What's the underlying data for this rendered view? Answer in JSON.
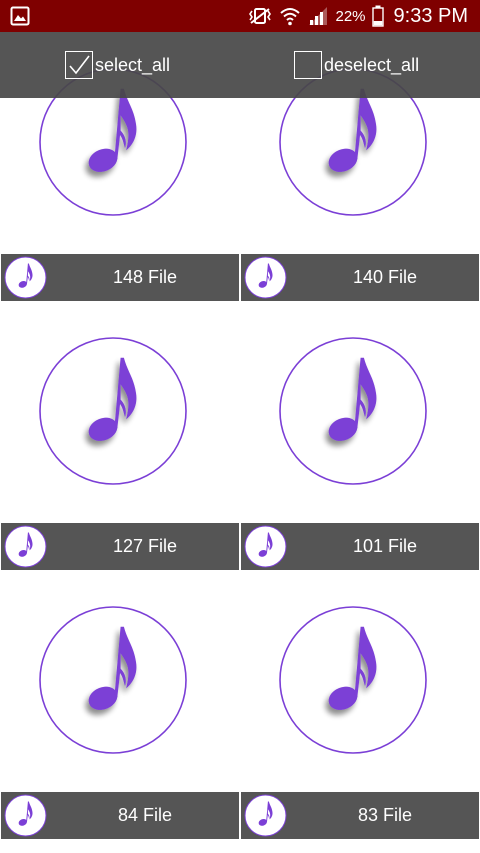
{
  "status_bar": {
    "battery_percent": "22%",
    "time": "9:33 PM",
    "bg_color": "#7f0000"
  },
  "toolbar": {
    "select_all_label": "select_all",
    "select_all_checked": true,
    "deselect_all_label": "deselect_all",
    "deselect_all_checked": false
  },
  "tiles": [
    {
      "count_label": "148 File"
    },
    {
      "count_label": "140 File"
    },
    {
      "count_label": "127 File"
    },
    {
      "count_label": "101 File"
    },
    {
      "count_label": "84 File"
    },
    {
      "count_label": "83 File"
    }
  ],
  "colors": {
    "accent": "#7b3fd6",
    "tile_bar": "#555555",
    "toolbar": "#464646"
  },
  "icons": {
    "tile_art": "music-note-icon",
    "tile_bar": "music-note-icon"
  }
}
